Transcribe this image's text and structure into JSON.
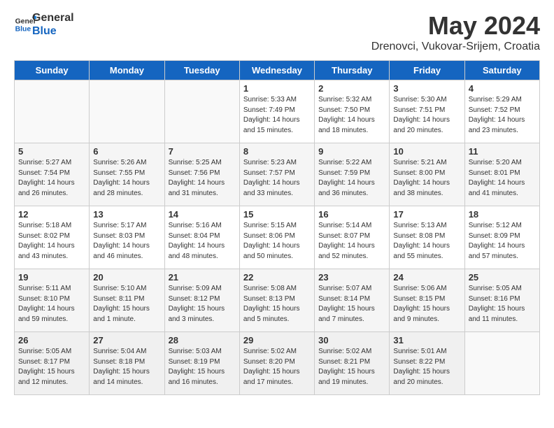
{
  "header": {
    "logo_general": "General",
    "logo_blue": "Blue",
    "month_title": "May 2024",
    "location": "Drenovci, Vukovar-Srijem, Croatia"
  },
  "days_of_week": [
    "Sunday",
    "Monday",
    "Tuesday",
    "Wednesday",
    "Thursday",
    "Friday",
    "Saturday"
  ],
  "weeks": [
    {
      "days": [
        {
          "number": "",
          "info": ""
        },
        {
          "number": "",
          "info": ""
        },
        {
          "number": "",
          "info": ""
        },
        {
          "number": "1",
          "info": "Sunrise: 5:33 AM\nSunset: 7:49 PM\nDaylight: 14 hours\nand 15 minutes."
        },
        {
          "number": "2",
          "info": "Sunrise: 5:32 AM\nSunset: 7:50 PM\nDaylight: 14 hours\nand 18 minutes."
        },
        {
          "number": "3",
          "info": "Sunrise: 5:30 AM\nSunset: 7:51 PM\nDaylight: 14 hours\nand 20 minutes."
        },
        {
          "number": "4",
          "info": "Sunrise: 5:29 AM\nSunset: 7:52 PM\nDaylight: 14 hours\nand 23 minutes."
        }
      ]
    },
    {
      "days": [
        {
          "number": "5",
          "info": "Sunrise: 5:27 AM\nSunset: 7:54 PM\nDaylight: 14 hours\nand 26 minutes."
        },
        {
          "number": "6",
          "info": "Sunrise: 5:26 AM\nSunset: 7:55 PM\nDaylight: 14 hours\nand 28 minutes."
        },
        {
          "number": "7",
          "info": "Sunrise: 5:25 AM\nSunset: 7:56 PM\nDaylight: 14 hours\nand 31 minutes."
        },
        {
          "number": "8",
          "info": "Sunrise: 5:23 AM\nSunset: 7:57 PM\nDaylight: 14 hours\nand 33 minutes."
        },
        {
          "number": "9",
          "info": "Sunrise: 5:22 AM\nSunset: 7:59 PM\nDaylight: 14 hours\nand 36 minutes."
        },
        {
          "number": "10",
          "info": "Sunrise: 5:21 AM\nSunset: 8:00 PM\nDaylight: 14 hours\nand 38 minutes."
        },
        {
          "number": "11",
          "info": "Sunrise: 5:20 AM\nSunset: 8:01 PM\nDaylight: 14 hours\nand 41 minutes."
        }
      ]
    },
    {
      "days": [
        {
          "number": "12",
          "info": "Sunrise: 5:18 AM\nSunset: 8:02 PM\nDaylight: 14 hours\nand 43 minutes."
        },
        {
          "number": "13",
          "info": "Sunrise: 5:17 AM\nSunset: 8:03 PM\nDaylight: 14 hours\nand 46 minutes."
        },
        {
          "number": "14",
          "info": "Sunrise: 5:16 AM\nSunset: 8:04 PM\nDaylight: 14 hours\nand 48 minutes."
        },
        {
          "number": "15",
          "info": "Sunrise: 5:15 AM\nSunset: 8:06 PM\nDaylight: 14 hours\nand 50 minutes."
        },
        {
          "number": "16",
          "info": "Sunrise: 5:14 AM\nSunset: 8:07 PM\nDaylight: 14 hours\nand 52 minutes."
        },
        {
          "number": "17",
          "info": "Sunrise: 5:13 AM\nSunset: 8:08 PM\nDaylight: 14 hours\nand 55 minutes."
        },
        {
          "number": "18",
          "info": "Sunrise: 5:12 AM\nSunset: 8:09 PM\nDaylight: 14 hours\nand 57 minutes."
        }
      ]
    },
    {
      "days": [
        {
          "number": "19",
          "info": "Sunrise: 5:11 AM\nSunset: 8:10 PM\nDaylight: 14 hours\nand 59 minutes."
        },
        {
          "number": "20",
          "info": "Sunrise: 5:10 AM\nSunset: 8:11 PM\nDaylight: 15 hours\nand 1 minute."
        },
        {
          "number": "21",
          "info": "Sunrise: 5:09 AM\nSunset: 8:12 PM\nDaylight: 15 hours\nand 3 minutes."
        },
        {
          "number": "22",
          "info": "Sunrise: 5:08 AM\nSunset: 8:13 PM\nDaylight: 15 hours\nand 5 minutes."
        },
        {
          "number": "23",
          "info": "Sunrise: 5:07 AM\nSunset: 8:14 PM\nDaylight: 15 hours\nand 7 minutes."
        },
        {
          "number": "24",
          "info": "Sunrise: 5:06 AM\nSunset: 8:15 PM\nDaylight: 15 hours\nand 9 minutes."
        },
        {
          "number": "25",
          "info": "Sunrise: 5:05 AM\nSunset: 8:16 PM\nDaylight: 15 hours\nand 11 minutes."
        }
      ]
    },
    {
      "days": [
        {
          "number": "26",
          "info": "Sunrise: 5:05 AM\nSunset: 8:17 PM\nDaylight: 15 hours\nand 12 minutes."
        },
        {
          "number": "27",
          "info": "Sunrise: 5:04 AM\nSunset: 8:18 PM\nDaylight: 15 hours\nand 14 minutes."
        },
        {
          "number": "28",
          "info": "Sunrise: 5:03 AM\nSunset: 8:19 PM\nDaylight: 15 hours\nand 16 minutes."
        },
        {
          "number": "29",
          "info": "Sunrise: 5:02 AM\nSunset: 8:20 PM\nDaylight: 15 hours\nand 17 minutes."
        },
        {
          "number": "30",
          "info": "Sunrise: 5:02 AM\nSunset: 8:21 PM\nDaylight: 15 hours\nand 19 minutes."
        },
        {
          "number": "31",
          "info": "Sunrise: 5:01 AM\nSunset: 8:22 PM\nDaylight: 15 hours\nand 20 minutes."
        },
        {
          "number": "",
          "info": ""
        }
      ]
    }
  ]
}
